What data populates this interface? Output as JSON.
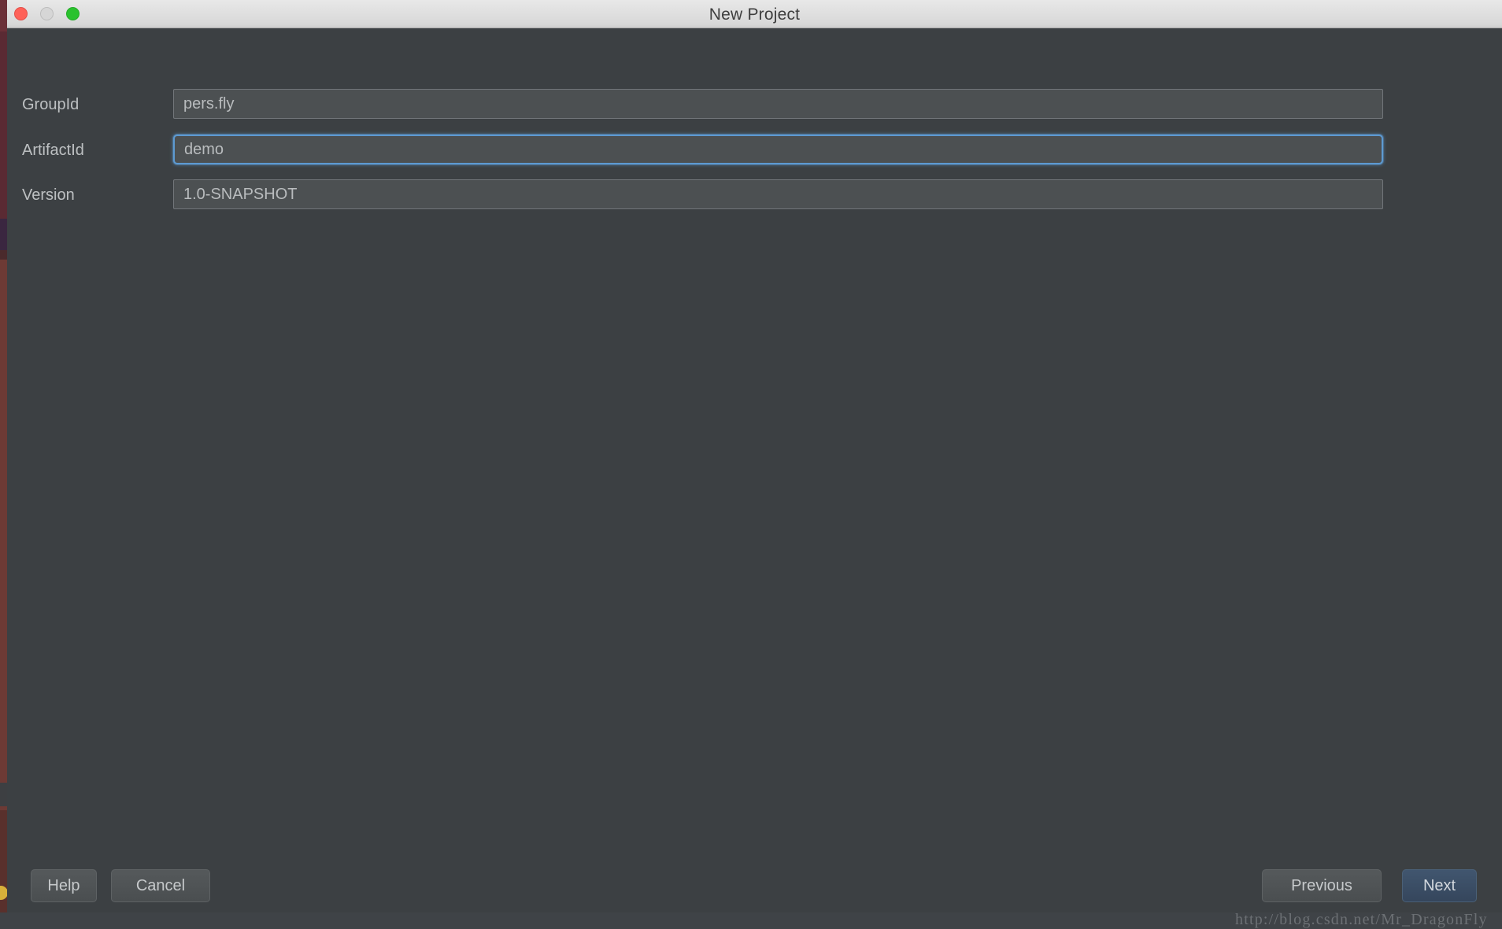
{
  "window": {
    "title": "New Project",
    "traffic_lights": {
      "close": "close-button",
      "minimize": "minimize-button",
      "maximize": "maximize-button"
    }
  },
  "form": {
    "fields": [
      {
        "label": "GroupId",
        "value": "pers.fly",
        "placeholder": "GroupId",
        "focused": false
      },
      {
        "label": "ArtifactId",
        "value": "demo",
        "placeholder": "ArtifactId",
        "focused": true
      },
      {
        "label": "Version",
        "value": "1.0-SNAPSHOT",
        "placeholder": "Version",
        "focused": false
      }
    ]
  },
  "footer": {
    "help_label": "Help",
    "cancel_label": "Cancel",
    "previous_label": "Previous",
    "next_label": "Next"
  },
  "watermark": {
    "text": "http://blog.csdn.net/Mr_DragonFly"
  },
  "colors": {
    "window_background": "#3c4043",
    "titlebar_top": "#e8e8e8",
    "titlebar_bottom": "#cfcfcf",
    "field_background": "#4c5052",
    "field_border": "#72767a",
    "focus_accent": "#5d9ad2",
    "text_primary": "#bdc0c2",
    "default_button_background": "#41566f",
    "traffic_close": "#fe6158",
    "traffic_minimize": "#d6d6d6",
    "traffic_maximize": "#2ac22e"
  }
}
